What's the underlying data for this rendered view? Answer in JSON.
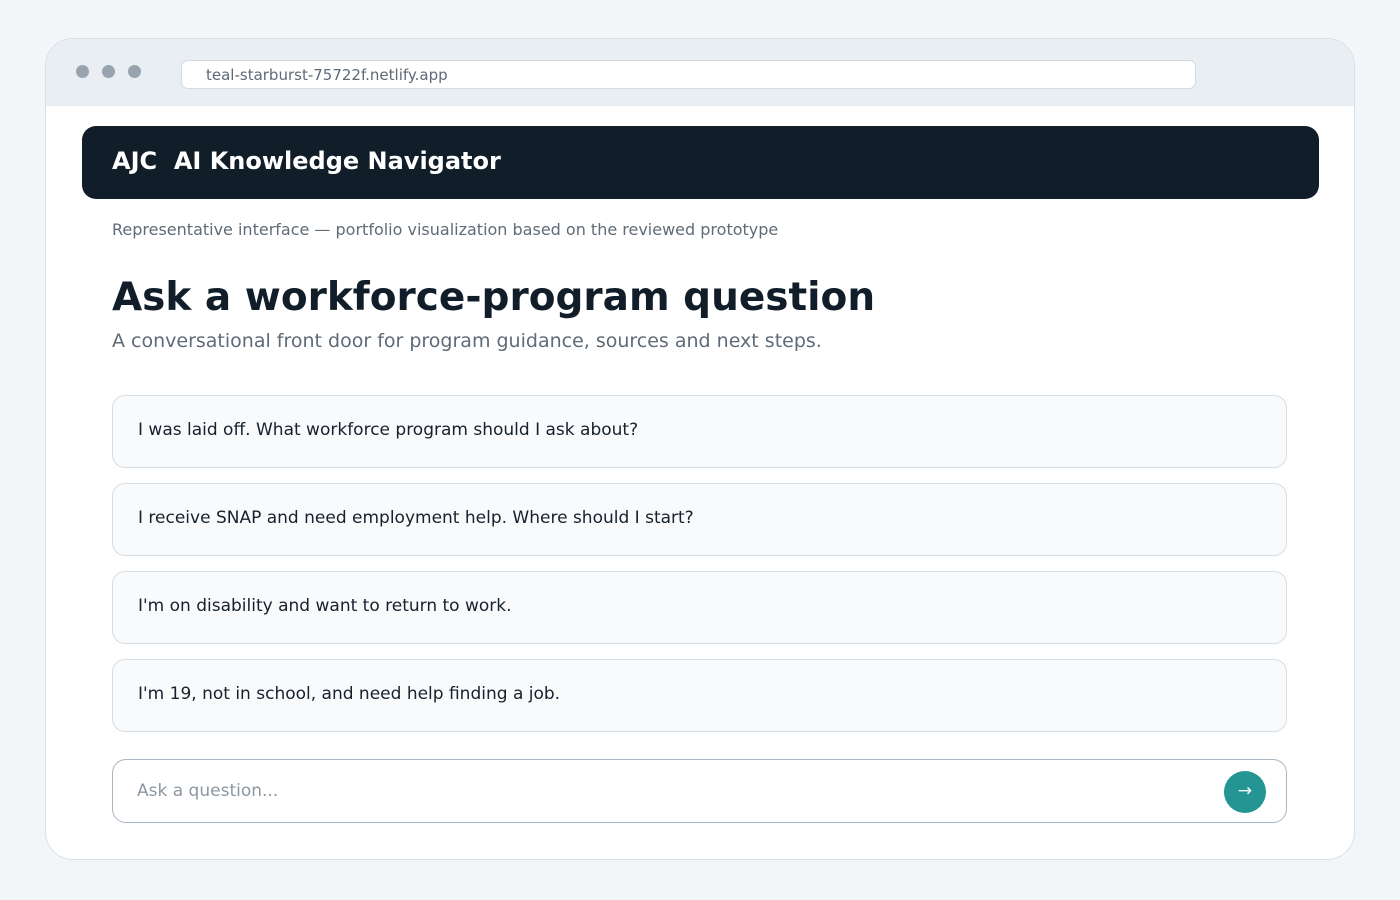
{
  "browser": {
    "url": "teal-starburst-75722f.netlify.app"
  },
  "header": {
    "brand": "AJC  AI Knowledge Navigator"
  },
  "main": {
    "disclaimer": "Representative interface — portfolio visualization based on the reviewed prototype",
    "title": "Ask a workforce-program question",
    "subtitle": "A conversational front door for program guidance, sources and next steps.",
    "suggestions": [
      "I was laid off. What workforce program should I ask about?",
      "I receive SNAP and need employment help. Where should I start?",
      "I'm on disability and want to return to work.",
      "I'm 19, not in school, and need help finding a job."
    ]
  },
  "ask": {
    "placeholder": "Ask a question...",
    "value": "",
    "send_icon": "→"
  },
  "colors": {
    "header_bg": "#111e2a",
    "accent": "#249593",
    "page_bg": "#f3f6f9"
  }
}
